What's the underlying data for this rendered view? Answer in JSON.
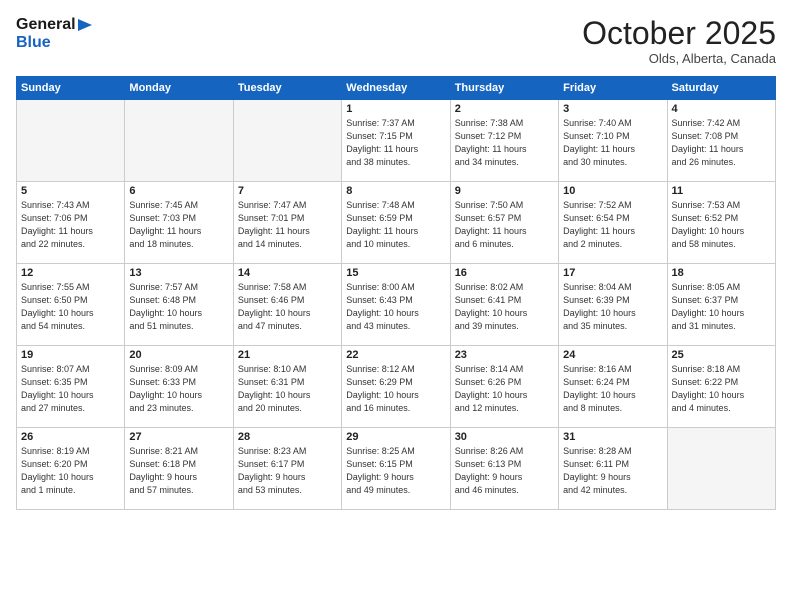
{
  "header": {
    "logo_line1": "General",
    "logo_line2": "Blue",
    "month_title": "October 2025",
    "location": "Olds, Alberta, Canada"
  },
  "days_of_week": [
    "Sunday",
    "Monday",
    "Tuesday",
    "Wednesday",
    "Thursday",
    "Friday",
    "Saturday"
  ],
  "weeks": [
    [
      {
        "num": "",
        "info": ""
      },
      {
        "num": "",
        "info": ""
      },
      {
        "num": "",
        "info": ""
      },
      {
        "num": "1",
        "info": "Sunrise: 7:37 AM\nSunset: 7:15 PM\nDaylight: 11 hours\nand 38 minutes."
      },
      {
        "num": "2",
        "info": "Sunrise: 7:38 AM\nSunset: 7:12 PM\nDaylight: 11 hours\nand 34 minutes."
      },
      {
        "num": "3",
        "info": "Sunrise: 7:40 AM\nSunset: 7:10 PM\nDaylight: 11 hours\nand 30 minutes."
      },
      {
        "num": "4",
        "info": "Sunrise: 7:42 AM\nSunset: 7:08 PM\nDaylight: 11 hours\nand 26 minutes."
      }
    ],
    [
      {
        "num": "5",
        "info": "Sunrise: 7:43 AM\nSunset: 7:06 PM\nDaylight: 11 hours\nand 22 minutes."
      },
      {
        "num": "6",
        "info": "Sunrise: 7:45 AM\nSunset: 7:03 PM\nDaylight: 11 hours\nand 18 minutes."
      },
      {
        "num": "7",
        "info": "Sunrise: 7:47 AM\nSunset: 7:01 PM\nDaylight: 11 hours\nand 14 minutes."
      },
      {
        "num": "8",
        "info": "Sunrise: 7:48 AM\nSunset: 6:59 PM\nDaylight: 11 hours\nand 10 minutes."
      },
      {
        "num": "9",
        "info": "Sunrise: 7:50 AM\nSunset: 6:57 PM\nDaylight: 11 hours\nand 6 minutes."
      },
      {
        "num": "10",
        "info": "Sunrise: 7:52 AM\nSunset: 6:54 PM\nDaylight: 11 hours\nand 2 minutes."
      },
      {
        "num": "11",
        "info": "Sunrise: 7:53 AM\nSunset: 6:52 PM\nDaylight: 10 hours\nand 58 minutes."
      }
    ],
    [
      {
        "num": "12",
        "info": "Sunrise: 7:55 AM\nSunset: 6:50 PM\nDaylight: 10 hours\nand 54 minutes."
      },
      {
        "num": "13",
        "info": "Sunrise: 7:57 AM\nSunset: 6:48 PM\nDaylight: 10 hours\nand 51 minutes."
      },
      {
        "num": "14",
        "info": "Sunrise: 7:58 AM\nSunset: 6:46 PM\nDaylight: 10 hours\nand 47 minutes."
      },
      {
        "num": "15",
        "info": "Sunrise: 8:00 AM\nSunset: 6:43 PM\nDaylight: 10 hours\nand 43 minutes."
      },
      {
        "num": "16",
        "info": "Sunrise: 8:02 AM\nSunset: 6:41 PM\nDaylight: 10 hours\nand 39 minutes."
      },
      {
        "num": "17",
        "info": "Sunrise: 8:04 AM\nSunset: 6:39 PM\nDaylight: 10 hours\nand 35 minutes."
      },
      {
        "num": "18",
        "info": "Sunrise: 8:05 AM\nSunset: 6:37 PM\nDaylight: 10 hours\nand 31 minutes."
      }
    ],
    [
      {
        "num": "19",
        "info": "Sunrise: 8:07 AM\nSunset: 6:35 PM\nDaylight: 10 hours\nand 27 minutes."
      },
      {
        "num": "20",
        "info": "Sunrise: 8:09 AM\nSunset: 6:33 PM\nDaylight: 10 hours\nand 23 minutes."
      },
      {
        "num": "21",
        "info": "Sunrise: 8:10 AM\nSunset: 6:31 PM\nDaylight: 10 hours\nand 20 minutes."
      },
      {
        "num": "22",
        "info": "Sunrise: 8:12 AM\nSunset: 6:29 PM\nDaylight: 10 hours\nand 16 minutes."
      },
      {
        "num": "23",
        "info": "Sunrise: 8:14 AM\nSunset: 6:26 PM\nDaylight: 10 hours\nand 12 minutes."
      },
      {
        "num": "24",
        "info": "Sunrise: 8:16 AM\nSunset: 6:24 PM\nDaylight: 10 hours\nand 8 minutes."
      },
      {
        "num": "25",
        "info": "Sunrise: 8:18 AM\nSunset: 6:22 PM\nDaylight: 10 hours\nand 4 minutes."
      }
    ],
    [
      {
        "num": "26",
        "info": "Sunrise: 8:19 AM\nSunset: 6:20 PM\nDaylight: 10 hours\nand 1 minute."
      },
      {
        "num": "27",
        "info": "Sunrise: 8:21 AM\nSunset: 6:18 PM\nDaylight: 9 hours\nand 57 minutes."
      },
      {
        "num": "28",
        "info": "Sunrise: 8:23 AM\nSunset: 6:17 PM\nDaylight: 9 hours\nand 53 minutes."
      },
      {
        "num": "29",
        "info": "Sunrise: 8:25 AM\nSunset: 6:15 PM\nDaylight: 9 hours\nand 49 minutes."
      },
      {
        "num": "30",
        "info": "Sunrise: 8:26 AM\nSunset: 6:13 PM\nDaylight: 9 hours\nand 46 minutes."
      },
      {
        "num": "31",
        "info": "Sunrise: 8:28 AM\nSunset: 6:11 PM\nDaylight: 9 hours\nand 42 minutes."
      },
      {
        "num": "",
        "info": ""
      }
    ]
  ]
}
